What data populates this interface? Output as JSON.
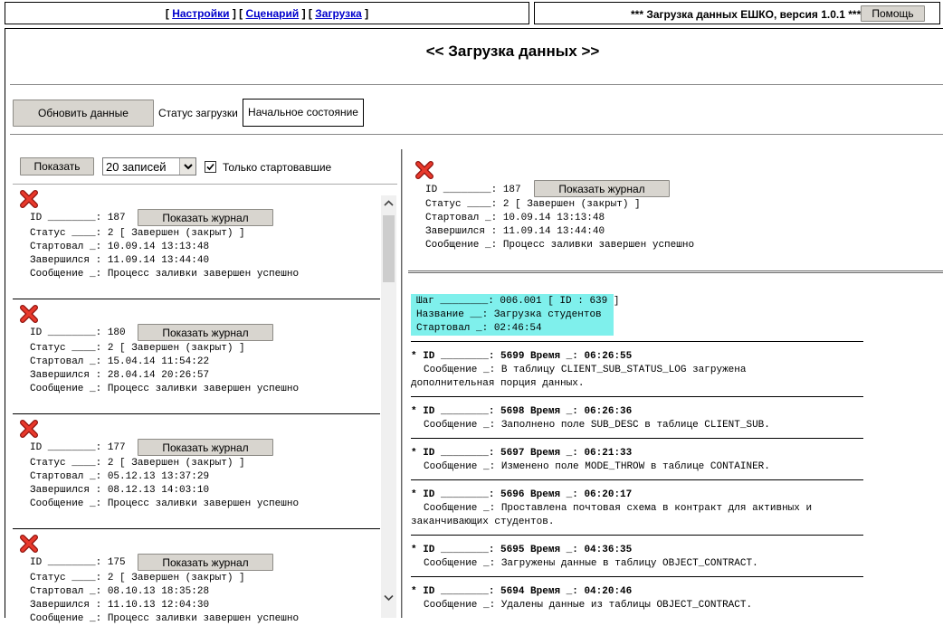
{
  "nav": {
    "open1": "[ ",
    "link1": "Настройки",
    "mid1": " ] [ ",
    "link2": "Сценарий",
    "mid2": " ] [ ",
    "link3": "Загрузка",
    "close3": " ]"
  },
  "header": {
    "title": "*** Загрузка данных ЕШКО, версия 1.0.1 ***",
    "help_label": "Помощь"
  },
  "page_title": "<< Загрузка данных >>",
  "toolbar": {
    "refresh_label": "Обновить данные",
    "status_label": "Статус загрузки",
    "status_value": "Начальное состояние"
  },
  "filter": {
    "show_label": "Показать",
    "select_value": "20 записей",
    "checkbox_label": "Только стартовавшие",
    "checked": true
  },
  "labels": {
    "id": "ID ________: ",
    "status": "Статус ____: ",
    "started": "Стартовал _: ",
    "finished": "Завершился : ",
    "message": "Сообщение _: ",
    "journal_button": "Показать журнал"
  },
  "records": [
    {
      "id": "187",
      "status": "2 [ Завершен (закрыт) ]",
      "started": "10.09.14 13:13:48",
      "finished": "11.09.14 13:44:40",
      "message": "Процесс заливки завершен успешно"
    },
    {
      "id": "180",
      "status": "2 [ Завершен (закрыт) ]",
      "started": "15.04.14 11:54:22",
      "finished": "28.04.14 20:26:57",
      "message": "Процесс заливки завершен успешно"
    },
    {
      "id": "177",
      "status": "2 [ Завершен (закрыт) ]",
      "started": "05.12.13 13:37:29",
      "finished": "08.12.13 14:03:10",
      "message": "Процесс заливки завершен успешно"
    },
    {
      "id": "175",
      "status": "2 [ Завершен (закрыт) ]",
      "started": "08.10.13 18:35:28",
      "finished": "11.10.13 12:04:30",
      "message": "Процесс заливки завершен успешно"
    }
  ],
  "detail": {
    "id": "187",
    "status": "2 [ Завершен (закрыт) ]",
    "started": "10.09.14 13:13:48",
    "finished": "11.09.14 13:44:40",
    "message": "Процесс заливки завершен успешно"
  },
  "step": {
    "l1_label": "Шаг ________: ",
    "l1_value": "006.001 [ ID : 639 ]",
    "l2_label": "Название __: ",
    "l2_value": "Загрузка студентов",
    "l3_label": "Стартовал _: ",
    "l3_value": "02:46:54",
    "highlight": "#7ff0ec"
  },
  "log_labels": {
    "prefix": "* ID ________: ",
    "time": " Время _: ",
    "message": "Сообщение _: "
  },
  "log": [
    {
      "id": "5699",
      "time": "06:26:55",
      "message": "В таблицу CLIENT_SUB_STATUS_LOG загружена",
      "message2": "дополнительная порция данных."
    },
    {
      "id": "5698",
      "time": "06:26:36",
      "message": "Заполнено поле SUB_DESC в таблице CLIENT_SUB.",
      "message2": ""
    },
    {
      "id": "5697",
      "time": "06:21:33",
      "message": "Изменено поле MODE_THROW в таблице CONTAINER.",
      "message2": ""
    },
    {
      "id": "5696",
      "time": "06:20:17",
      "message": "Проставлена почтовая схема в контракт для активных и",
      "message2": "заканчивающих студентов."
    },
    {
      "id": "5695",
      "time": "04:36:35",
      "message": "Загружены данные в таблицу OBJECT_CONTRACT.",
      "message2": ""
    },
    {
      "id": "5694",
      "time": "04:20:46",
      "message": "Удалены данные из таблицы OBJECT_CONTRACT.",
      "message2": ""
    }
  ],
  "icons": {
    "delete": "red-x-icon",
    "check": "check-icon",
    "chevron": "chevron-down-icon"
  },
  "colors": {
    "link": "#0000cc",
    "icon_red": "#d9261c",
    "step_highlight": "#7ff0ec"
  }
}
